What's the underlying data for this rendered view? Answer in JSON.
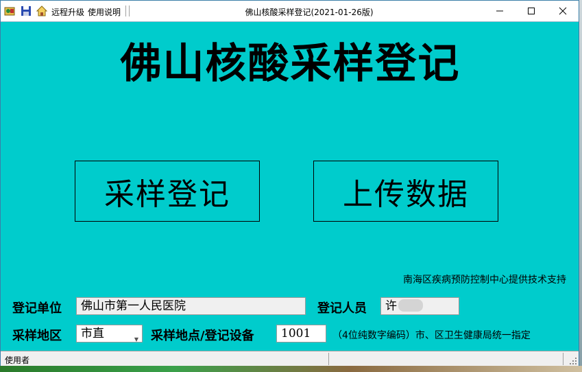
{
  "titlebar": {
    "window_title": "佛山核酸采样登记(2021-01-26版)",
    "menu": [
      "远程升级",
      "使用说明"
    ],
    "icons": [
      "app-icon",
      "save-icon",
      "home-icon"
    ],
    "controls": [
      "minimize-icon",
      "maximize-icon",
      "close-icon"
    ]
  },
  "main": {
    "title": "佛山核酸采样登记",
    "buttons": {
      "register": "采样登记",
      "upload": "上传数据"
    },
    "support_text": "南海区疾病预防控制中心提供技术支持"
  },
  "form": {
    "unit_label": "登记单位",
    "unit_value": "佛山市第一人民医院",
    "person_label": "登记人员",
    "person_value": "许",
    "area_label": "采样地区",
    "area_value": "市直",
    "site_label": "采样地点/登记设备",
    "site_value": "1001",
    "site_hint": "（4位纯数字编码）市、区卫生健康局统一指定"
  },
  "status": {
    "text": "使用者"
  },
  "colors": {
    "window_bg": "#00cccc",
    "titlebar_bg": "#ffffff",
    "status_bg": "#f0f0f0"
  }
}
